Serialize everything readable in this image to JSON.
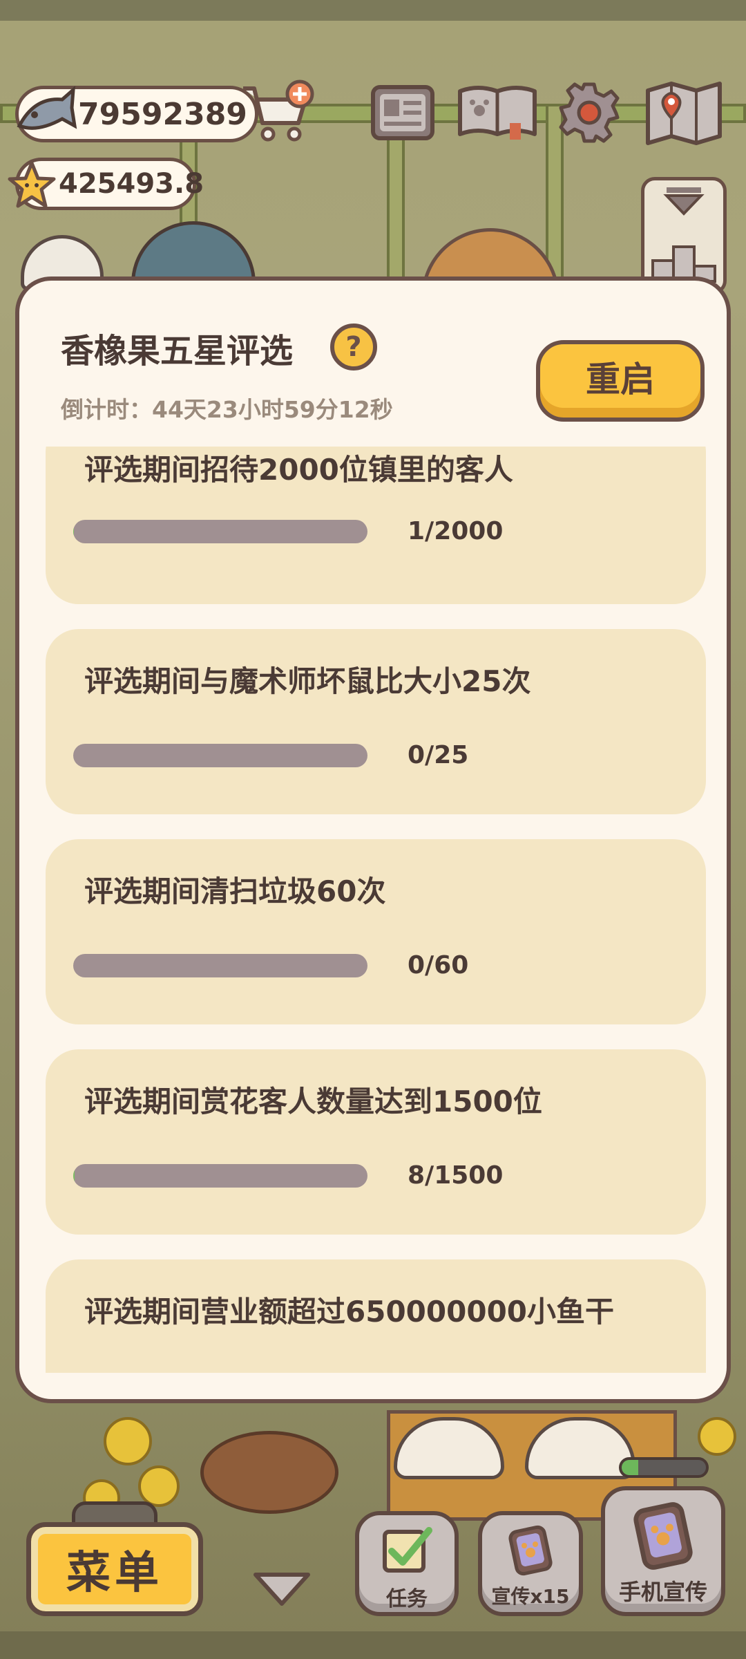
{
  "hud": {
    "fish_amount": "79592389",
    "star_amount": "425493.8"
  },
  "modal": {
    "title": "香橡果五星评选",
    "help_glyph": "?",
    "countdown": "倒计时：44天23小时59分12秒",
    "restart_label": "重启",
    "tasks": [
      {
        "title": "评选期间招待2000位镇里的客人",
        "progress": "1/2000",
        "fraction": 0.0005
      },
      {
        "title": "评选期间与魔术师坏鼠比大小25次",
        "progress": "0/25",
        "fraction": 0
      },
      {
        "title": "评选期间清扫垃圾60次",
        "progress": "0/60",
        "fraction": 0
      },
      {
        "title": "评选期间赏花客人数量达到1500位",
        "progress": "8/1500",
        "fraction": 0.0053
      },
      {
        "title": "评选期间营业额超过650000000小鱼干",
        "progress": "",
        "fraction": 0
      }
    ]
  },
  "bottom_bar": {
    "menu_label": "菜单",
    "task_label": "任务",
    "promo_label": "宣传x15",
    "phone_promo_label": "手机宣传",
    "promo_meter_fraction": 0.2
  },
  "colors": {
    "accent_yellow": "#fbc43f",
    "outline_brown": "#6b5049",
    "card_bg": "#f4e6c4",
    "modal_bg": "#fdf6ec",
    "bar_bg": "#a09092"
  },
  "icons": {
    "fish": "fish-icon",
    "star": "star-icon",
    "cart": "cart-add-icon",
    "newspaper": "newspaper-icon",
    "book": "paw-book-icon",
    "settings": "gear-icon",
    "map": "map-pin-icon",
    "ranking": "ranking-icon",
    "help": "question-icon",
    "task": "checklist-icon",
    "promo": "phone-paw-icon",
    "collapse": "chevron-down-icon"
  }
}
